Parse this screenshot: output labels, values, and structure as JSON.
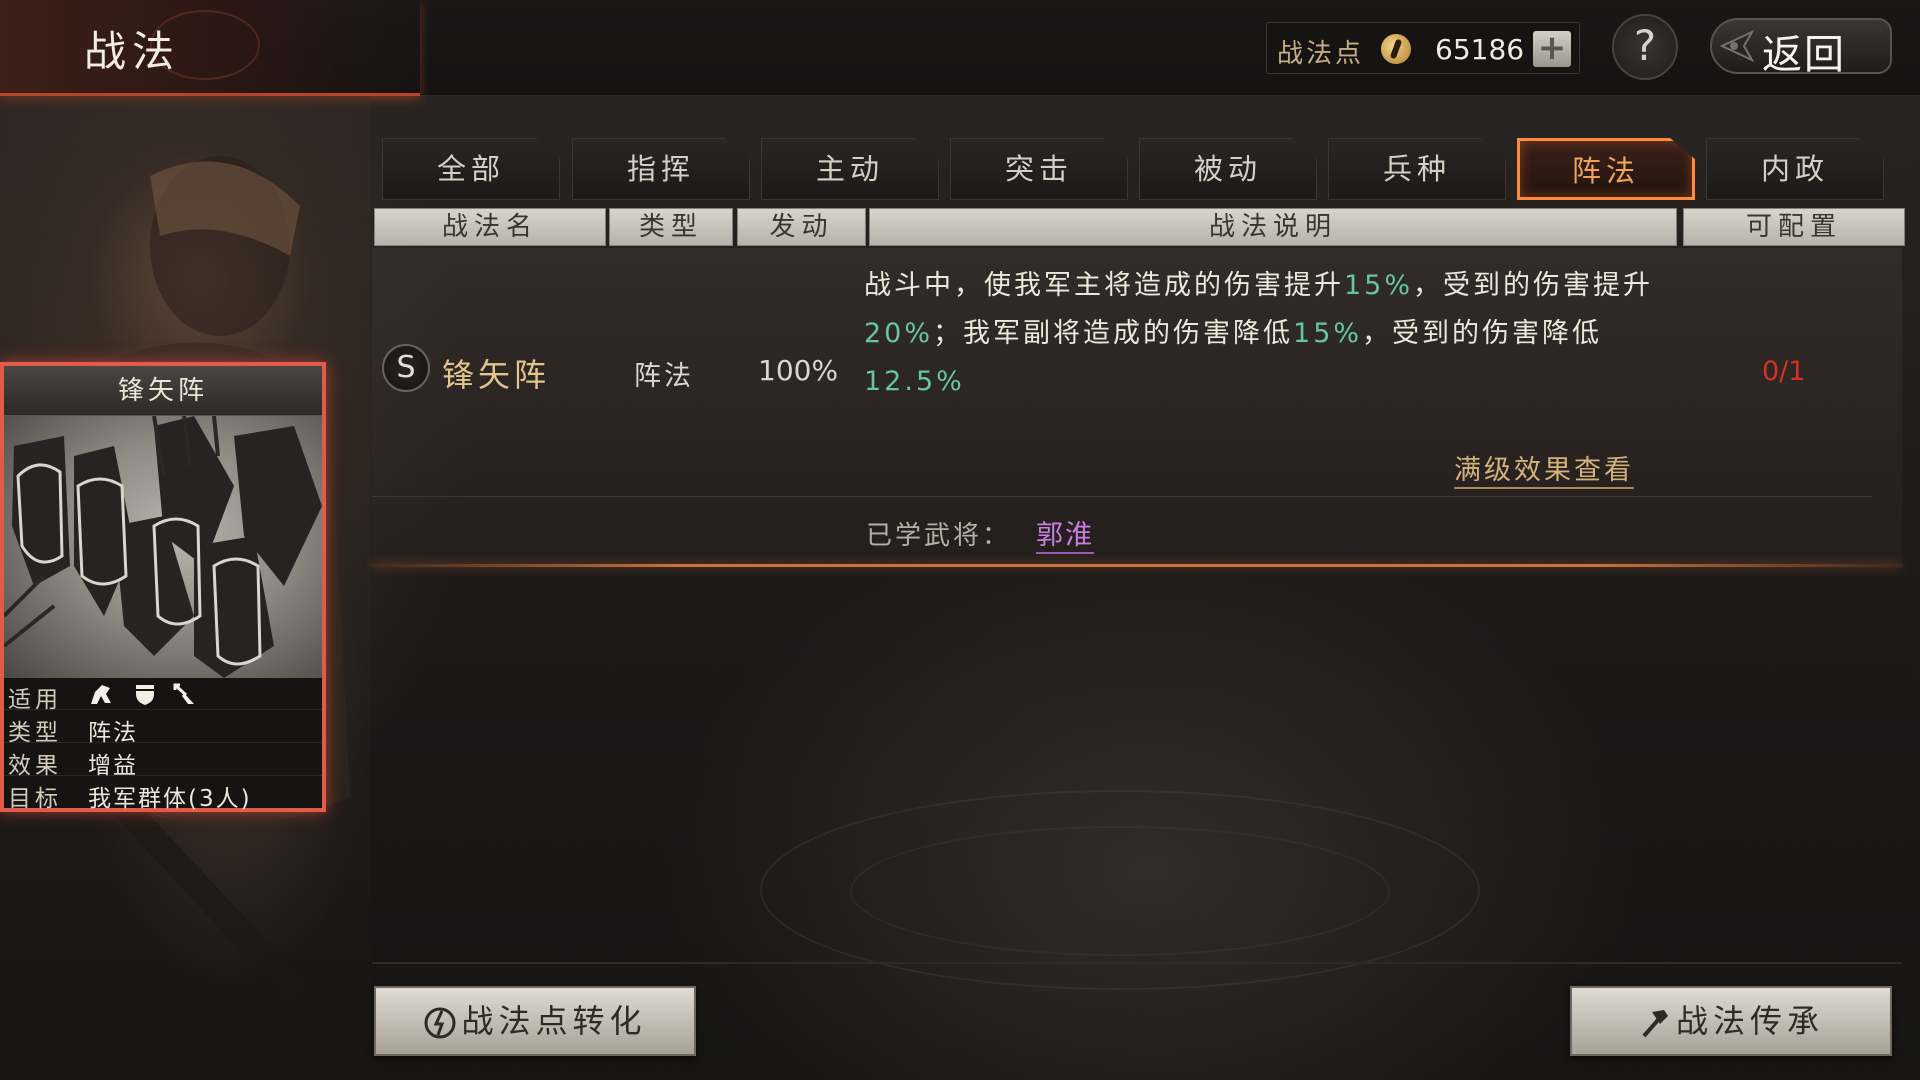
{
  "header": {
    "title": "战法",
    "points_label": "战法点",
    "points_value": "65186",
    "add_label": "+",
    "help_label": "?",
    "back_label": "返回"
  },
  "tabs": [
    {
      "label": "全部",
      "active": false
    },
    {
      "label": "指挥",
      "active": false
    },
    {
      "label": "主动",
      "active": false
    },
    {
      "label": "突击",
      "active": false
    },
    {
      "label": "被动",
      "active": false
    },
    {
      "label": "兵种",
      "active": false
    },
    {
      "label": "阵法",
      "active": true
    },
    {
      "label": "内政",
      "active": false
    }
  ],
  "table": {
    "headers": {
      "name": "战法名",
      "type": "类型",
      "rate": "发动",
      "desc": "战法说明",
      "slots": "可配置"
    }
  },
  "skill": {
    "grade": "S",
    "name": "锋矢阵",
    "type": "阵法",
    "rate": "100%",
    "desc": {
      "p1": "战斗中，使我军主将造成的伤害提升",
      "v1": "15%",
      "p2": "，受到的伤害提升",
      "v2": "20%",
      "p3": "；我军副将造成的伤害降低",
      "v3": "15%",
      "p4": "，受到的伤害降低",
      "v4": "12.5%"
    },
    "slots": "0/1",
    "full_effect_label": "满级效果查看",
    "learned_label": "已学武将：",
    "learned_general": "郭淮"
  },
  "card": {
    "name": "锋矢阵",
    "stats": {
      "apply_key": "适用",
      "type_key": "类型",
      "type_val": "阵法",
      "effect_key": "效果",
      "effect_val": "增益",
      "target_key": "目标",
      "target_val": "我军群体(3人)"
    },
    "troop_icons": [
      "cavalry-icon",
      "shield-icon",
      "archer-icon"
    ]
  },
  "buttons": {
    "convert_label": "战法点转化",
    "inherit_label": "战法传承"
  },
  "colors": {
    "accent_orange": "#ff8a3c",
    "highlight_green": "#66c79c",
    "slots_red": "#d83020",
    "general_purple": "#c77ee0",
    "skill_gold": "#e3c48d"
  }
}
